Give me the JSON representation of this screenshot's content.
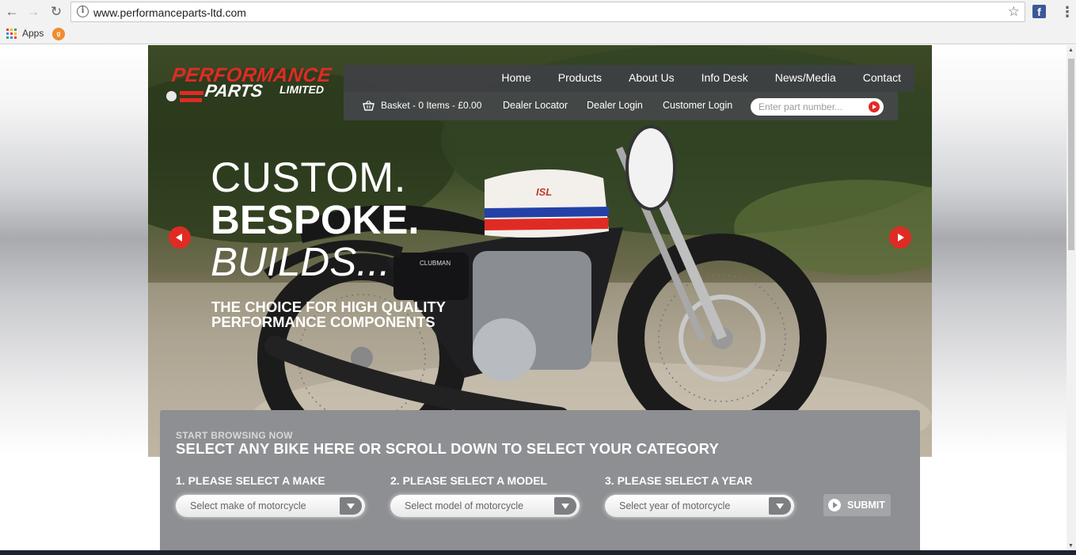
{
  "browser": {
    "url": "www.performanceparts-ltd.com",
    "bookmarks": [
      {
        "label": "Apps"
      }
    ]
  },
  "site": {
    "logo": {
      "line1": "PERFORMANCE",
      "line2": "PARTS",
      "line3": "LIMITED"
    },
    "nav": [
      "Home",
      "Products",
      "About Us",
      "Info Desk",
      "News/Media",
      "Contact"
    ],
    "subnav": {
      "basket": "Basket - 0 Items - £0.00",
      "dealer_locator": "Dealer Locator",
      "dealer_login": "Dealer Login",
      "customer_login": "Customer Login",
      "search_placeholder": "Enter part number..."
    },
    "hero": {
      "line1": "CUSTOM.",
      "line2": "BESPOKE.",
      "line3": "BUILDS...",
      "tagline1": "THE CHOICE FOR HIGH QUALITY",
      "tagline2": "PERFORMANCE COMPONENTS",
      "bike_tank_text": "CLUBMAN",
      "bike_tank_badge": "ISL"
    },
    "selector": {
      "kicker": "START BROWSING NOW",
      "title": "SELECT ANY BIKE HERE OR SCROLL DOWN TO SELECT YOUR CATEGORY",
      "steps": [
        {
          "label": "1. PLEASE SELECT A MAKE",
          "value": "Select make of motorcycle"
        },
        {
          "label": "2. PLEASE SELECT A MODEL",
          "value": "Select model of motorcycle"
        },
        {
          "label": "3. PLEASE SELECT A YEAR",
          "value": "Select year of motorcycle"
        }
      ],
      "submit": "SUBMIT"
    }
  },
  "colors": {
    "brand_red": "#e02b24",
    "panel_grey": "#8e8f92",
    "nav_dark": "#3e4044"
  }
}
